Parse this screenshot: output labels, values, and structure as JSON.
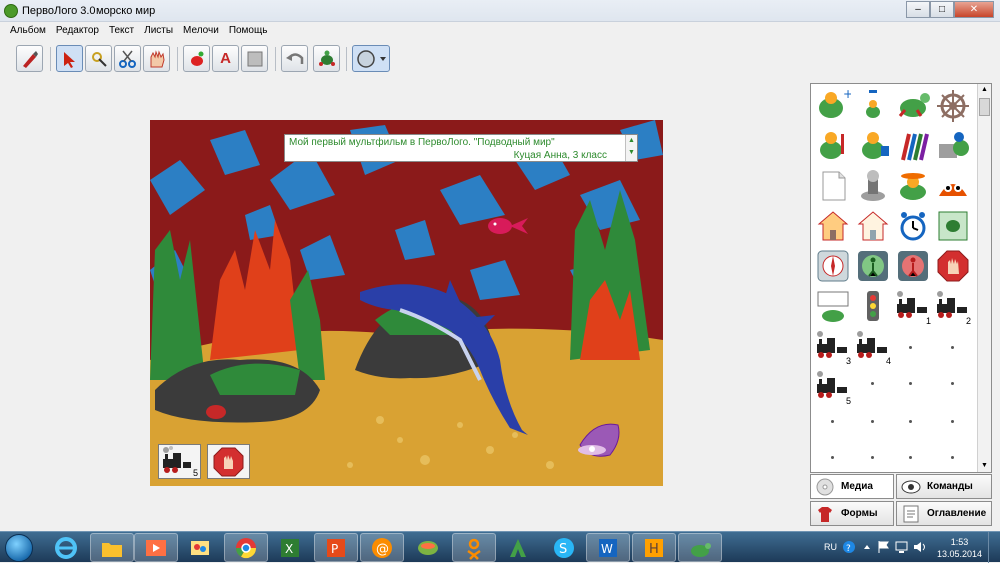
{
  "window": {
    "app_name": "ПервоЛого 3.0",
    "document_name": "морско мир",
    "controls": [
      "–",
      "□",
      "✕"
    ]
  },
  "menu": [
    "Альбом",
    "Редактор",
    "Текст",
    "Листы",
    "Мелочи",
    "Помощь"
  ],
  "toolbar": {
    "tools": [
      "brush-tool",
      "arrow-tool",
      "hand-drag-tool",
      "scissors-tool",
      "glove-tool",
      "turtle-tool",
      "text-tool",
      "stamp-tool",
      "undo-tool",
      "new-turtle-tool",
      "shape-selector"
    ],
    "text_icon": "A"
  },
  "scene": {
    "text_line1": "Мой первый мультфильм в ПервоЛого. \"Подводный мир\"",
    "text_line2": "Куцая Анна, 3 класс",
    "button_train_number": "5"
  },
  "panel": {
    "train_numbers": [
      "1",
      "2",
      "3",
      "4",
      "5"
    ],
    "scroll_up": "▲",
    "scroll_down": "▼",
    "tabs": {
      "media": "Медиа",
      "commands": "Команды",
      "forms": "Формы",
      "contents": "Оглавление"
    }
  },
  "taskbar": {
    "language": "RU",
    "time": "1:53",
    "date": "13.05.2014",
    "apps": [
      "explorer",
      "ie",
      "folder",
      "media",
      "paint",
      "chrome",
      "excel",
      "powerpoint",
      "mail-agent",
      "icq",
      "odnoklassniki",
      "arc",
      "skype",
      "word",
      "h-app",
      "pervologo"
    ]
  },
  "colors": {
    "scene_background": "#8b1a1a",
    "sand": "#d9a233",
    "water": "#2c7fc4",
    "text_green": "#2e8b2e"
  }
}
